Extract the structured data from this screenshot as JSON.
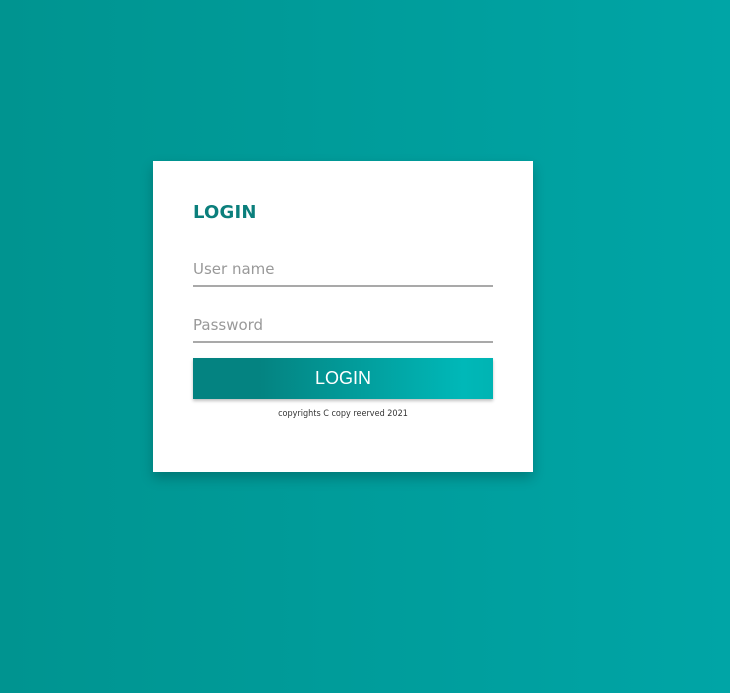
{
  "login_card": {
    "title": "LOGIN",
    "username_placeholder": "User name",
    "password_placeholder": "Password",
    "submit_label": "LOGIN",
    "footer_text": "copyrights C copy reerved 2021"
  },
  "colors": {
    "background_start": "#009490",
    "background_end": "#00a5a6",
    "title": "#0b7f7c",
    "button_start": "#048381",
    "button_end": "#00b8b8"
  }
}
